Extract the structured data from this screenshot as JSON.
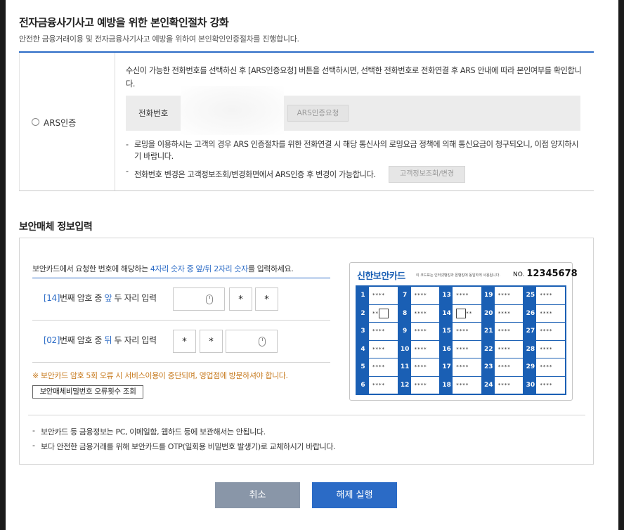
{
  "header": {
    "title": "전자금융사기사고 예방을 위한 본인확인절차 강화",
    "subtitle": "안전한 금융거래이용 및 전자금융사기사고 예방을 위하여 본인확인인증절차를 진행합니다."
  },
  "ars": {
    "option_label": "ARS인증",
    "description": "수신이 가능한 전화번호를 선택하신 후 [ARS인증요청] 버튼을 선택하시면, 선택한 전화번호로 전화연결 후 ARS 안내에 따라 본인여부를 확인합니다.",
    "phone_label": "전화번호",
    "request_button": "ARS인증요청",
    "note_roaming": "로밍을 이용하시는 고객의 경우 ARS 인증절차를 위한 전화연결 시 해당 통신사의 로밍요금 정책에 의해 통신요금이 청구되오니, 이점 양지하시기 바랍니다.",
    "note_change": "전화번호 변경은 고객정보조회/변경화면에서 ARS인증 후 변경이 가능합니다.",
    "change_button": "고객정보조회/변경"
  },
  "security": {
    "section_title": "보안매체 정보입력",
    "instr_prefix": "보안카드에서 요청한 번호에 해당하는 ",
    "instr_highlight": "4자리 숫자 중 앞/뒤 2자리 숫자",
    "instr_suffix": "를 입력하세요.",
    "row1": {
      "num": "[14]",
      "text_a": "번째 암호 중 ",
      "pos": "앞",
      "text_b": " 두 자리 입력",
      "star1": "*",
      "star2": "*"
    },
    "row2": {
      "num": "[02]",
      "text_a": "번째 암호 중 ",
      "pos": "뒤",
      "text_b": " 두 자리 입력",
      "star1": "*",
      "star2": "*"
    },
    "warning": "※ 보안카드 암호 5회 오류 시 서비스이용이 중단되며, 영업점에 방문하셔야 합니다.",
    "error_button": "보안매체비밀번호 오류횟수 조회",
    "footnote1": "보안카드 등 금융정보는 PC, 이메일함, 웹하드 등에 보관해서는 안됩니다.",
    "footnote2": "보다 안전한 금융거래를 위해 보안카드를 OTP(일회용 비밀번호 발생기)로 교체하시기 바랍니다."
  },
  "card": {
    "name": "신한보안카드",
    "small_text": "이 코드표는 인터넷뱅킹과 폰뱅킹에 동일하게 사용됩니다.",
    "no_prefix": "NO.",
    "number": "12345678",
    "mask": "****",
    "cells": [
      {
        "n": "1",
        "v": "****"
      },
      {
        "n": "7",
        "v": "****"
      },
      {
        "n": "13",
        "v": "****"
      },
      {
        "n": "19",
        "v": "****"
      },
      {
        "n": "25",
        "v": "****"
      },
      {
        "n": "2",
        "v": "**",
        "box": "end"
      },
      {
        "n": "8",
        "v": "****"
      },
      {
        "n": "14",
        "v": "**",
        "box": "start"
      },
      {
        "n": "20",
        "v": "****"
      },
      {
        "n": "26",
        "v": "****"
      },
      {
        "n": "3",
        "v": "****"
      },
      {
        "n": "9",
        "v": "****"
      },
      {
        "n": "15",
        "v": "****"
      },
      {
        "n": "21",
        "v": "****"
      },
      {
        "n": "27",
        "v": "****"
      },
      {
        "n": "4",
        "v": "****"
      },
      {
        "n": "10",
        "v": "****"
      },
      {
        "n": "16",
        "v": "****"
      },
      {
        "n": "22",
        "v": "****"
      },
      {
        "n": "28",
        "v": "****"
      },
      {
        "n": "5",
        "v": "****"
      },
      {
        "n": "11",
        "v": "****"
      },
      {
        "n": "17",
        "v": "****"
      },
      {
        "n": "23",
        "v": "****"
      },
      {
        "n": "29",
        "v": "****"
      },
      {
        "n": "6",
        "v": "****"
      },
      {
        "n": "12",
        "v": "****"
      },
      {
        "n": "18",
        "v": "****"
      },
      {
        "n": "24",
        "v": "****"
      },
      {
        "n": "30",
        "v": "****"
      }
    ]
  },
  "actions": {
    "cancel": "취소",
    "submit": "해제 실행"
  },
  "colors": {
    "accent": "#2b6bc6",
    "card_blue": "#1a5fb4",
    "warning": "#c77a1e",
    "cancel_bg": "#8996a8"
  }
}
